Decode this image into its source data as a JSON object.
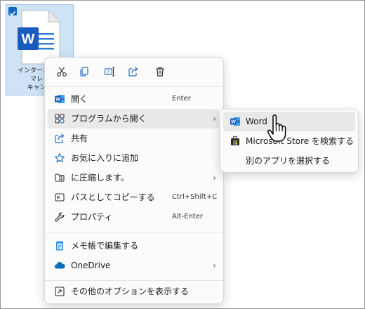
{
  "desktop_file": {
    "label_lines": [
      "インターネット",
      "マレク",
      "キャンプ"
    ],
    "icon": "word-document-icon",
    "selected": true
  },
  "context_menu": {
    "quick_actions": [
      {
        "name": "cut",
        "icon": "cut-icon"
      },
      {
        "name": "copy",
        "icon": "copy-icon"
      },
      {
        "name": "rename",
        "icon": "rename-icon"
      },
      {
        "name": "share",
        "icon": "share-icon"
      },
      {
        "name": "delete",
        "icon": "trash-icon"
      }
    ],
    "items": [
      {
        "label": "開く",
        "shortcut": "Enter",
        "icon": "word-icon"
      },
      {
        "label": "プログラムから開く",
        "icon": "open-with-icon",
        "has_submenu": true
      },
      {
        "label": "共有",
        "icon": "share-icon"
      },
      {
        "label": "お気に入りに追加",
        "icon": "star-icon"
      },
      {
        "label": "に圧縮します。",
        "icon": "compress-icon",
        "has_submenu": true
      },
      {
        "label": "パスとしてコピーする",
        "shortcut": "Ctrl+Shift+C",
        "icon": "copy-path-icon"
      },
      {
        "label": "プロパティ",
        "shortcut": "Alt-Enter",
        "icon": "wrench-icon"
      },
      {
        "label": "メモ帳で編集する",
        "icon": "notepad-icon"
      },
      {
        "label": "OneDrive",
        "icon": "cloud-icon",
        "has_submenu": true
      },
      {
        "label": "その他のオプションを表示する",
        "icon": "more-options-icon"
      }
    ]
  },
  "submenu": {
    "items": [
      {
        "label": "Word",
        "icon": "word-icon"
      },
      {
        "label": "Microsoft Store を検索する",
        "icon": "store-icon"
      },
      {
        "label": "別のアプリを選択する"
      }
    ]
  },
  "colors": {
    "word_blue": "#185abd",
    "selection": "#e9e9e9",
    "accent": "#0067c0"
  }
}
